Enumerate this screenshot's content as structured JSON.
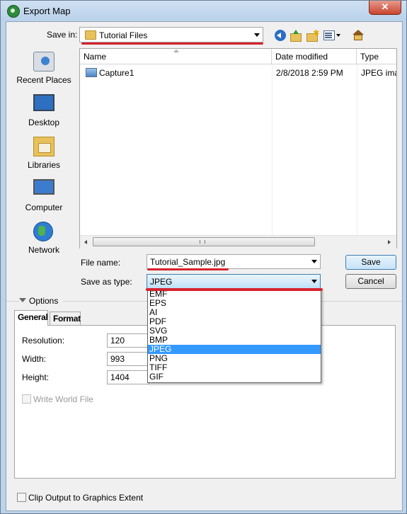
{
  "window": {
    "title": "Export Map",
    "close_label": "✕"
  },
  "toolbar": {
    "save_in_label": "Save in:",
    "save_in_value": "Tutorial Files"
  },
  "places": [
    {
      "label": "Recent Places"
    },
    {
      "label": "Desktop"
    },
    {
      "label": "Libraries"
    },
    {
      "label": "Computer"
    },
    {
      "label": "Network"
    }
  ],
  "filelist": {
    "columns": [
      "Name",
      "Date modified",
      "Type"
    ],
    "rows": [
      {
        "name": "Capture1",
        "date": "2/8/2018 2:59 PM",
        "type": "JPEG imag"
      }
    ],
    "scroll_grip": "III"
  },
  "form": {
    "file_name_label": "File name:",
    "file_name_value": "Tutorial_Sample.jpg",
    "save_type_label": "Save as type:",
    "save_type_value": "JPEG",
    "save_button": "Save",
    "cancel_button": "Cancel"
  },
  "type_options": [
    "EMF",
    "EPS",
    "AI",
    "PDF",
    "SVG",
    "BMP",
    "JPEG",
    "PNG",
    "TIFF",
    "GIF"
  ],
  "options": {
    "toggle_label": "Options",
    "tabs": [
      "General",
      "Format"
    ],
    "resolution_label": "Resolution:",
    "resolution_value": "120",
    "width_label": "Width:",
    "width_value": "993",
    "height_label": "Height:",
    "height_value": "1404",
    "world_file_label": "Write World File"
  },
  "footer": {
    "clip_label": "Clip Output to Graphics Extent"
  },
  "colors": {
    "accent": "#3399ff",
    "highlight_line": "#d6232d"
  }
}
